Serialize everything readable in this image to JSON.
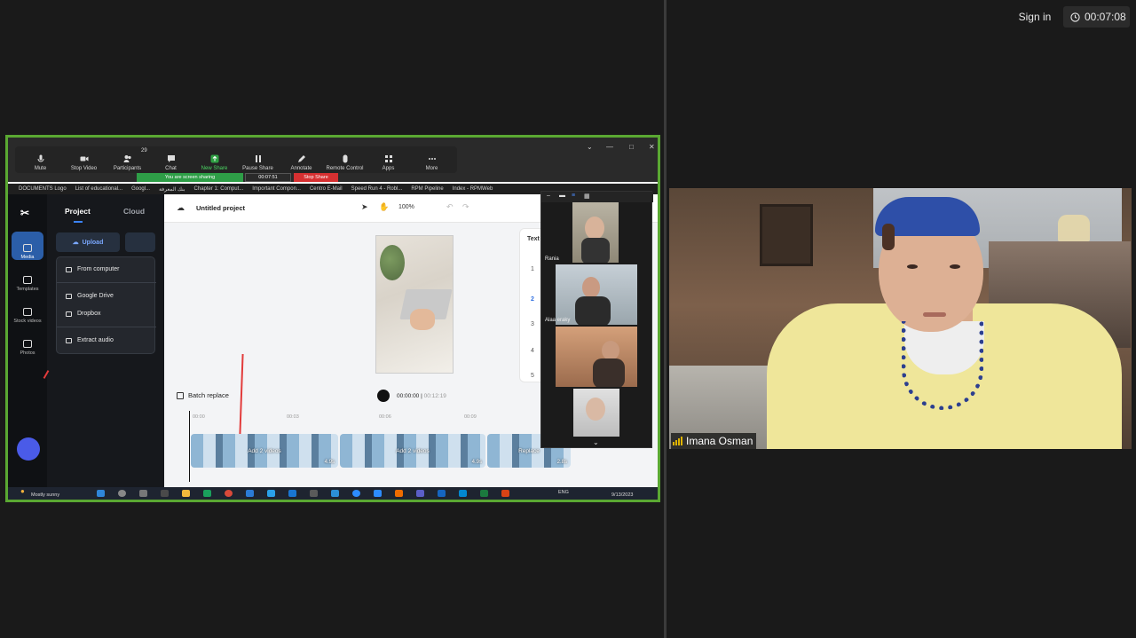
{
  "header": {
    "sign_in": "Sign in",
    "meeting_timer": "00:07:08"
  },
  "zoom_toolbar": {
    "mute": "Mute",
    "stop_video": "Stop Video",
    "participants": "Participants",
    "participants_count": "29",
    "chat": "Chat",
    "new_share": "New Share",
    "pause_share": "Pause Share",
    "annotate": "Annotate",
    "remote_control": "Remote Control",
    "apps": "Apps",
    "more": "More",
    "sharing_status": "You are screen sharing",
    "share_time": "00:07:51",
    "stop_share": "Stop Share"
  },
  "browser": {
    "url": "capcut.com/editor/...page_header&from_page=template_page&template_searc...",
    "bookmarks": [
      "DOCUMENTS Logo",
      "List of educational...",
      "Googl...",
      "بنك المعرفة",
      "Chapter 1: Comput...",
      "Important Compon...",
      "Centro E-Mail",
      "Speed Run 4 - Robl...",
      "RPM Pipeline",
      "Index - RPMWeb"
    ]
  },
  "capcut": {
    "rail": {
      "media": "Media",
      "templates": "Templates",
      "stock_videos": "Stock videos",
      "photos": "Photos"
    },
    "panel": {
      "tab_project": "Project",
      "tab_cloud": "Cloud",
      "upload": "Upload",
      "menu": {
        "from_computer": "From computer",
        "google_drive": "Google Drive",
        "dropbox": "Dropbox",
        "extract_audio": "Extract audio"
      }
    },
    "top": {
      "project_title": "Untitled project",
      "zoom": "100%"
    },
    "text_panel": {
      "title": "Text",
      "items": [
        "1",
        "2",
        "3",
        "4",
        "5"
      ]
    },
    "timeline": {
      "batch_replace": "Batch replace",
      "current_time": "00:00:00",
      "total_time": "00:12:19",
      "ruler": [
        "00:00",
        "00:03",
        "00:06",
        "00:09"
      ],
      "clips": [
        {
          "label": "Add 2 videos",
          "duration": "4.9s"
        },
        {
          "label": "Add 2 videos",
          "duration": "4.9s"
        },
        {
          "label": "Replace",
          "duration": "2.8s"
        }
      ]
    }
  },
  "gallery": {
    "participants": [
      "Rania",
      "Alaa eraky",
      "",
      ""
    ]
  },
  "taskbar": {
    "weather_temp": "",
    "weather": "Mostly sunny",
    "lang": "ENG",
    "date": "9/13/2023"
  },
  "active_speaker": {
    "name": "Imana Osman"
  },
  "colors": {
    "share_border": "#5aa832",
    "stop_share": "#d63031",
    "sharing_green": "#2e9e47",
    "capcut_accent": "#3b82f6"
  }
}
